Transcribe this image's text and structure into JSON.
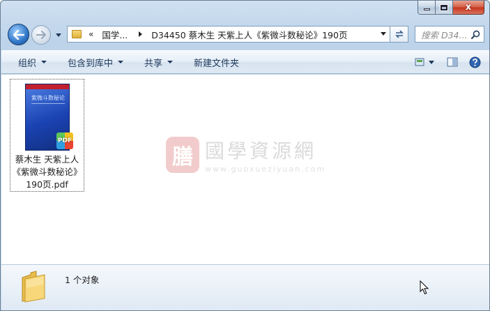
{
  "window": {
    "close_glyph": "x"
  },
  "nav": {
    "breadcrumb_overflow": "«",
    "breadcrumb_parent": "国学...",
    "breadcrumb_current": "D34450 蔡木生 天紫上人《紫微斗数秘论》190页",
    "search_placeholder": "搜索 D34..."
  },
  "toolbar": {
    "organize": "组织",
    "include_library": "包含到库中",
    "share": "共享",
    "new_folder": "新建文件夹"
  },
  "file": {
    "name": "蔡木生 天紫上人《紫微斗数秘论》190页.pdf",
    "thumb_title": "紫微斗数秘论",
    "badge": "PDF"
  },
  "watermark": {
    "seal": "膳",
    "name": "國學資源網",
    "url": "www.guoxueziyuan.com"
  },
  "details": {
    "count": "1 个对象"
  }
}
